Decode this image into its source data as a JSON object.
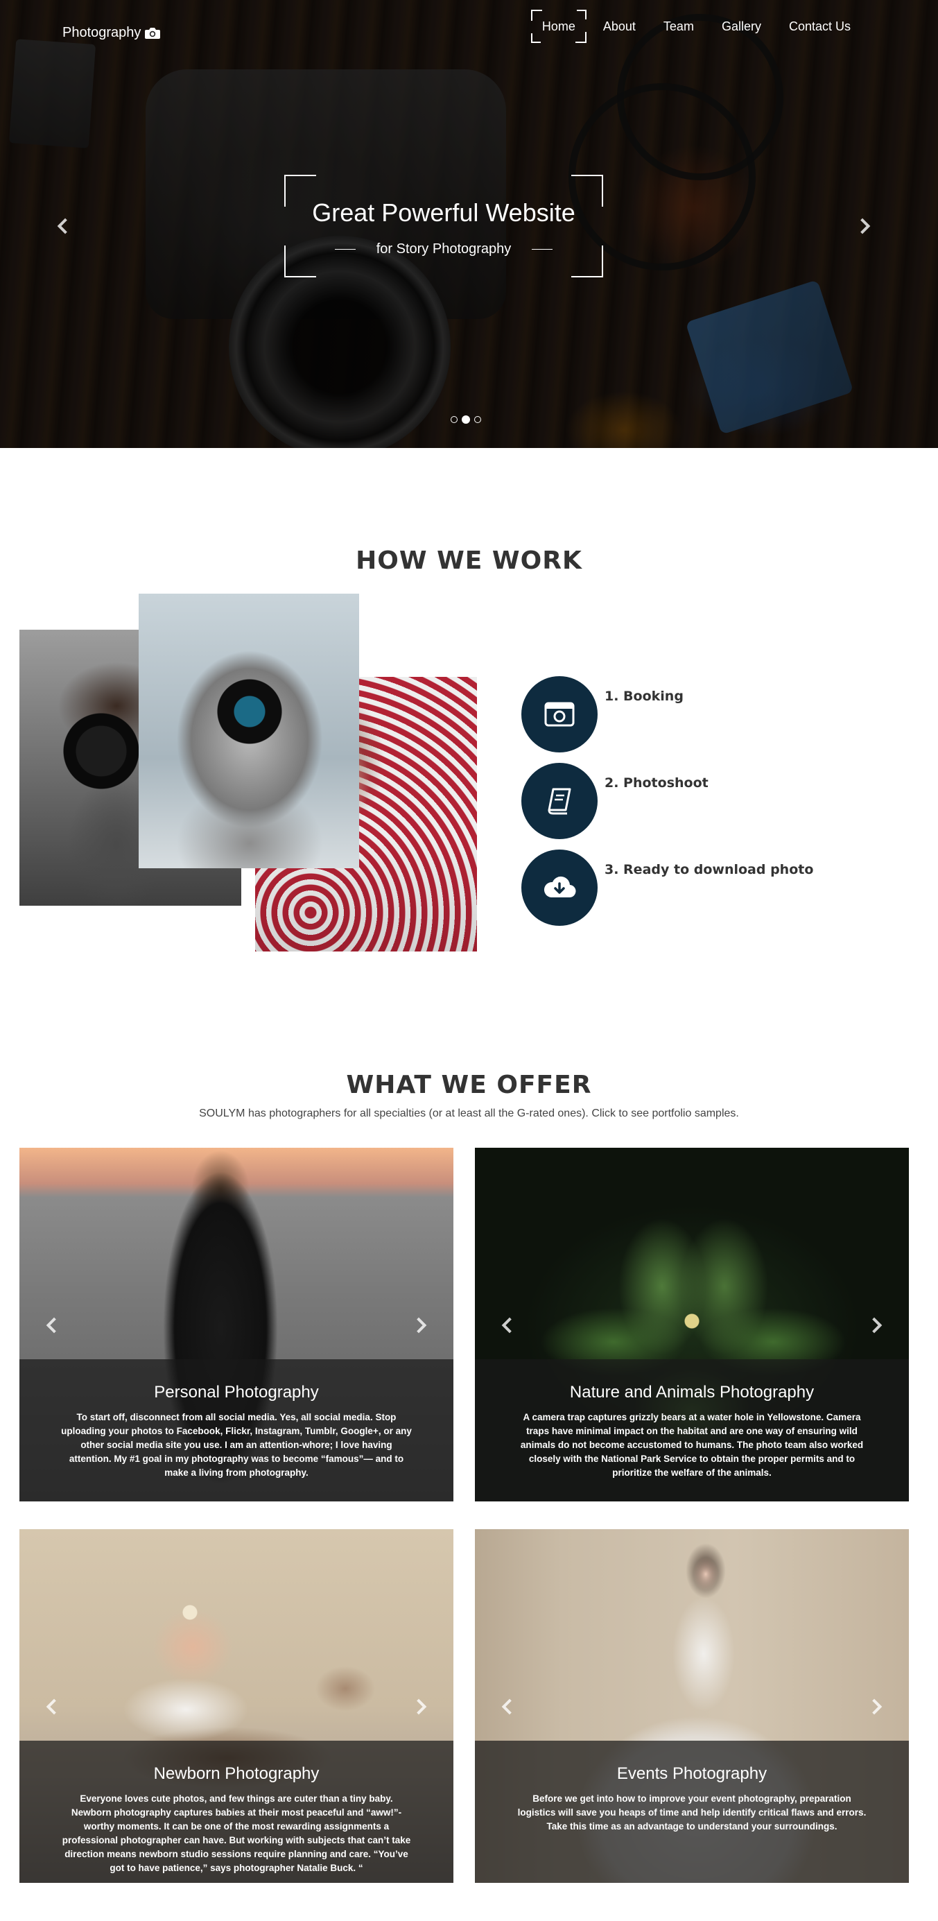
{
  "header": {
    "logo_text": "Photography",
    "nav": [
      {
        "label": "Home",
        "active": true
      },
      {
        "label": "About",
        "active": false
      },
      {
        "label": "Team",
        "active": false
      },
      {
        "label": "Gallery",
        "active": false
      },
      {
        "label": "Contact Us",
        "active": false
      }
    ]
  },
  "hero": {
    "title": "Great Powerful Website",
    "subtitle": "for Story Photography",
    "slides_total": 3,
    "active_slide": 2,
    "icons": {
      "prev": "chevron-left-icon",
      "next": "chevron-right-icon",
      "logo": "camera-icon"
    }
  },
  "how_we_work": {
    "title": "HOW WE WORK",
    "steps": [
      {
        "label": "1. Booking",
        "icon": "camera-box-icon"
      },
      {
        "label": "2. Photoshoot",
        "icon": "book-icon"
      },
      {
        "label": "3. Ready to download photo",
        "icon": "cloud-download-icon"
      }
    ],
    "accent_color": "#0e2b3f"
  },
  "what_we_offer": {
    "title": "WHAT WE OFFER",
    "subtitle": "SOULYM has photographers for all specialties (or at least all the G-rated ones). Click to see portfolio samples.",
    "cards": [
      {
        "title": "Personal Photography",
        "text": "To start off, disconnect from all social media. Yes, all social media. Stop uploading your photos to Facebook, Flickr, Instagram, Tumblr, Google+, or any other social media site you use. I am an attention-whore; I love having attention. My #1 goal in my photography was to become “famous”— and to make a living from photography."
      },
      {
        "title": "Nature and Animals Photography",
        "text": "A camera trap captures grizzly bears at a water hole in Yellowstone. Camera traps have minimal impact on the habitat and are one way of ensuring wild animals do not become accustomed to humans. The photo team also worked closely with the National Park Service to obtain the proper permits and to prioritize the welfare of the animals."
      },
      {
        "title": "Newborn Photography",
        "text": "Everyone loves cute photos, and few things are cuter than a tiny baby. Newborn photography captures babies at their most peaceful and “aww!”-worthy moments. It can be one of the most rewarding assignments a professional photographer can have. But working with subjects that can’t take direction means newborn studio sessions require planning and care. “You’ve got to have patience,” says photographer Natalie Buck. “"
      },
      {
        "title": "Events Photography",
        "text": "Before we get into how to improve your event photography, preparation logistics will save you heaps of time and help identify critical flaws and errors. Take this time as an advantage to understand your surroundings."
      }
    ]
  }
}
